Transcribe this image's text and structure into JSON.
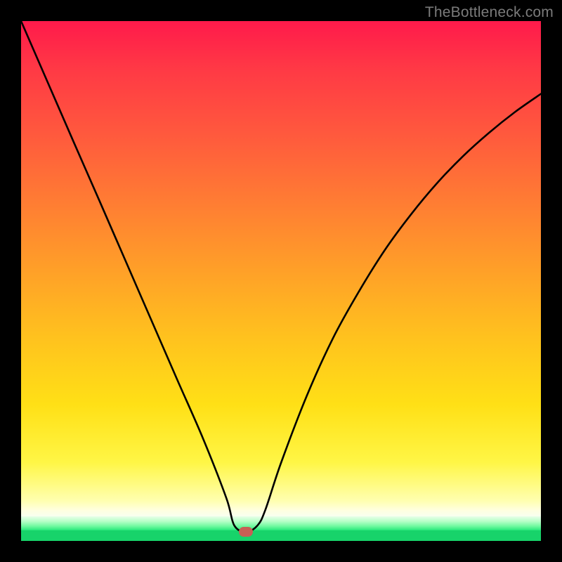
{
  "watermark": "TheBottleneck.com",
  "marker": {
    "x_frac": 0.433,
    "y_frac": 0.983
  },
  "colors": {
    "frame": "#000000",
    "curve": "#000000",
    "marker": "#c86055",
    "watermark": "#7b7b7b",
    "gradient_top": "#ff1a4b",
    "gradient_mid": "#ffc21e",
    "gradient_green": "#17d36a"
  },
  "chart_data": {
    "type": "line",
    "title": "",
    "xlabel": "",
    "ylabel": "",
    "xlim": [
      0,
      1
    ],
    "ylim": [
      0,
      1
    ],
    "annotations": [
      "TheBottleneck.com"
    ],
    "series": [
      {
        "name": "curve",
        "x": [
          0.0,
          0.05,
          0.1,
          0.15,
          0.2,
          0.25,
          0.3,
          0.35,
          0.395,
          0.41,
          0.433,
          0.455,
          0.47,
          0.5,
          0.55,
          0.6,
          0.65,
          0.7,
          0.75,
          0.8,
          0.85,
          0.9,
          0.95,
          1.0
        ],
        "y": [
          1.0,
          0.885,
          0.77,
          0.656,
          0.541,
          0.426,
          0.311,
          0.197,
          0.082,
          0.03,
          0.017,
          0.03,
          0.06,
          0.15,
          0.28,
          0.39,
          0.48,
          0.56,
          0.628,
          0.688,
          0.74,
          0.785,
          0.825,
          0.86
        ]
      }
    ],
    "marker_points": [
      {
        "name": "optimal",
        "x": 0.433,
        "y": 0.017
      }
    ],
    "background": {
      "type": "vertical-gradient",
      "stops": [
        {
          "pos": 0.0,
          "color": "#ff1a4b"
        },
        {
          "pos": 0.5,
          "color": "#ff9a2c"
        },
        {
          "pos": 0.82,
          "color": "#fff646"
        },
        {
          "pos": 0.93,
          "color": "#ffffdf"
        },
        {
          "pos": 0.97,
          "color": "#70f9a0"
        },
        {
          "pos": 1.0,
          "color": "#17d36a"
        }
      ]
    }
  }
}
